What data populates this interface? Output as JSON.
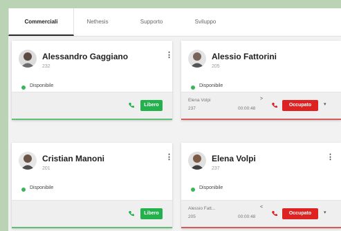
{
  "tabs": [
    {
      "label": "Commerciali",
      "active": true
    },
    {
      "label": "Nethesis",
      "active": false
    },
    {
      "label": "Supporto",
      "active": false
    },
    {
      "label": "Sviluppo",
      "active": false
    }
  ],
  "colors": {
    "available": "#3cb55a",
    "free_button": "#22b14c",
    "busy_button": "#dd2222",
    "free_border": "#5fbf73",
    "busy_border": "#d65a5a"
  },
  "operators": [
    {
      "name": "Alessandro Gaggiano",
      "ext": "232",
      "status": "Disponibile",
      "button": "Libero",
      "state": "free"
    },
    {
      "name": "Alessio Fattorini",
      "ext": "205",
      "status": "Disponibile",
      "button": "Occupato",
      "state": "busy",
      "call": {
        "name": "Elena Volpi",
        "ext": "237",
        "time": "00:00:48",
        "direction": ">"
      }
    },
    {
      "name": "Cristian Manoni",
      "ext": "201",
      "status": "Disponibile",
      "button": "Libero",
      "state": "free"
    },
    {
      "name": "Elena Volpi",
      "ext": "237",
      "status": "Disponibile",
      "button": "Occupato",
      "state": "busy",
      "call": {
        "name": "Alessio Fatt...",
        "ext": "205",
        "time": "00:00:48",
        "direction": "<"
      }
    }
  ]
}
